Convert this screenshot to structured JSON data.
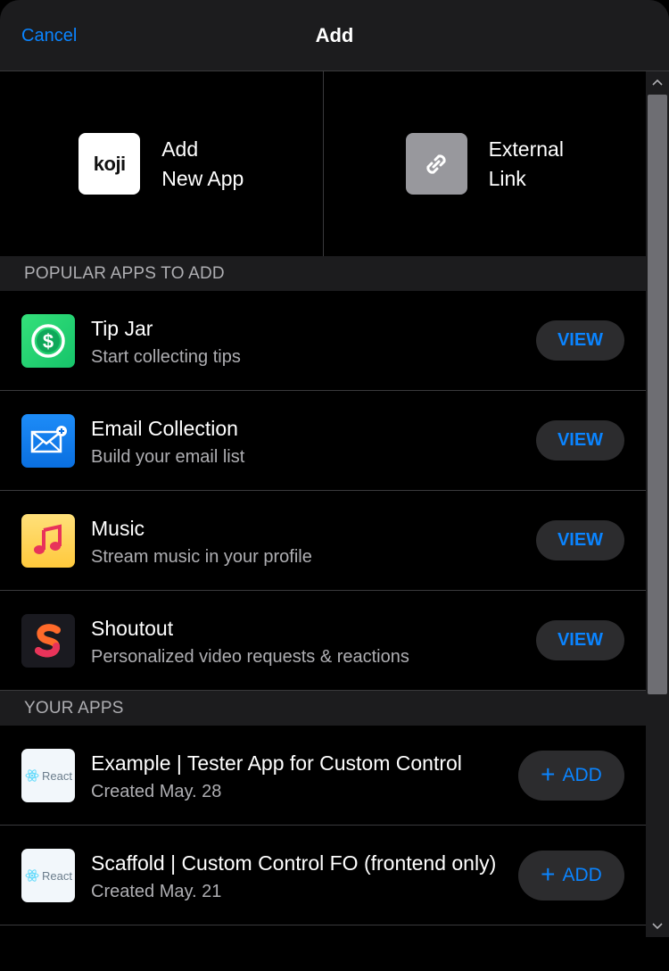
{
  "header": {
    "cancel_label": "Cancel",
    "title": "Add"
  },
  "tiles": [
    {
      "label": "Add\nNew App",
      "icon": "koji-logo-icon",
      "icon_text": "koji"
    },
    {
      "label": "External\nLink",
      "icon": "link-icon"
    }
  ],
  "popular": {
    "heading": "POPULAR APPS TO ADD",
    "items": [
      {
        "title": "Tip Jar",
        "subtitle": "Start collecting tips",
        "icon": "dollar-icon",
        "button": "VIEW"
      },
      {
        "title": "Email Collection",
        "subtitle": "Build your email list",
        "icon": "envelope-icon",
        "button": "VIEW"
      },
      {
        "title": "Music",
        "subtitle": "Stream music in your profile",
        "icon": "music-note-icon",
        "button": "VIEW"
      },
      {
        "title": "Shoutout",
        "subtitle": "Personalized video requests & reactions",
        "icon": "shoutout-icon",
        "button": "VIEW"
      }
    ]
  },
  "your_apps": {
    "heading": "YOUR APPS",
    "items": [
      {
        "title": "Example | Tester App for Custom Control",
        "subtitle": "Created May. 28",
        "icon_text": "React",
        "icon": "react-icon",
        "button": "ADD"
      },
      {
        "title": "Scaffold | Custom Control FO (frontend only)",
        "subtitle": "Created May. 21",
        "icon_text": "React",
        "icon": "react-icon",
        "button": "ADD"
      }
    ]
  },
  "colors": {
    "accent": "#0a84ff",
    "background": "#000000",
    "surface": "#1c1c1e",
    "button_bg": "#2c2c2e",
    "secondary_text": "#aeaeb2"
  }
}
